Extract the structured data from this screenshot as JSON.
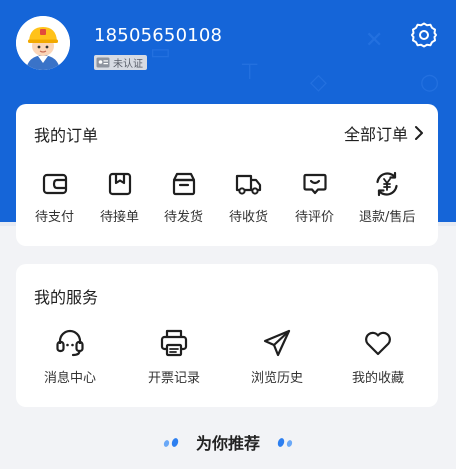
{
  "header": {
    "username": "18505650108",
    "verify_badge": "未认证",
    "colors": {
      "primary": "#1565d8"
    }
  },
  "orders": {
    "title": "我的订单",
    "all_label": "全部订单",
    "items": [
      {
        "label": "待支付",
        "icon": "wallet-icon"
      },
      {
        "label": "待接单",
        "icon": "package-icon"
      },
      {
        "label": "待发货",
        "icon": "box-icon"
      },
      {
        "label": "待收货",
        "icon": "truck-icon"
      },
      {
        "label": "待评价",
        "icon": "comment-icon"
      },
      {
        "label": "退款/售后",
        "icon": "refund-icon"
      }
    ]
  },
  "services": {
    "title": "我的服务",
    "items": [
      {
        "label": "消息中心",
        "icon": "headset-icon"
      },
      {
        "label": "开票记录",
        "icon": "printer-icon"
      },
      {
        "label": "浏览历史",
        "icon": "send-icon"
      },
      {
        "label": "我的收藏",
        "icon": "heart-icon"
      }
    ]
  },
  "recommend": {
    "title": "为你推荐"
  }
}
